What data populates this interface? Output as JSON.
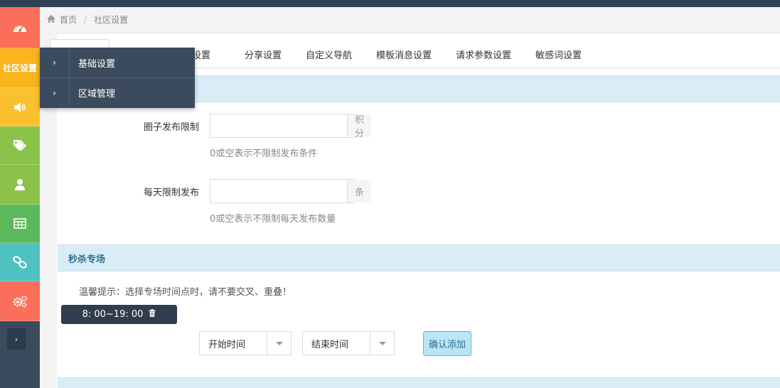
{
  "breadcrumb": {
    "home": "首页",
    "separator": "/",
    "current": "社区设置"
  },
  "sidebar": {
    "items": [
      {
        "name": "dashboard-icon",
        "color": "#fa6e5a"
      },
      {
        "label": "社区设置",
        "color": "#f9b51c"
      },
      {
        "name": "volume-icon",
        "color": "#fbc02d"
      },
      {
        "name": "tags-icon",
        "color": "#8bc34a"
      },
      {
        "name": "user-icon",
        "color": "#8bc34a"
      },
      {
        "name": "table-icon",
        "color": "#5cb85c"
      },
      {
        "name": "link-icon",
        "color": "#4fc1c1"
      },
      {
        "name": "gears-icon",
        "color": "#fa6e5a"
      }
    ],
    "toggle": "›"
  },
  "flyout": {
    "items": [
      {
        "chevron": "›",
        "label": "基础设置"
      },
      {
        "chevron": "›",
        "label": "区域管理"
      }
    ]
  },
  "tabs": [
    "户设置",
    "分享设置",
    "自定义导航",
    "模板消息设置",
    "请求参数设置",
    "敏感词设置"
  ],
  "form": {
    "circle_limit": {
      "label": "圈子发布限制",
      "value": "",
      "addon": "积分",
      "help": "0或空表示不限制发布条件"
    },
    "daily_limit": {
      "label": "每天限制发布",
      "value": "",
      "addon": "条",
      "help": "0或空表示不限制每天发布数量"
    }
  },
  "flash_sale": {
    "title": "秒杀专场",
    "tip": "温馨提示：选择专场时间点时，请不要交叉、重叠！",
    "slot": "8: 00~19: 00",
    "start_select": "开始时间",
    "end_select": "结束时间",
    "confirm": "确认添加"
  },
  "colors": {
    "accent": "#d9edf7",
    "sidebar": "#3a4b5e",
    "dark": "#2f3d4c"
  }
}
